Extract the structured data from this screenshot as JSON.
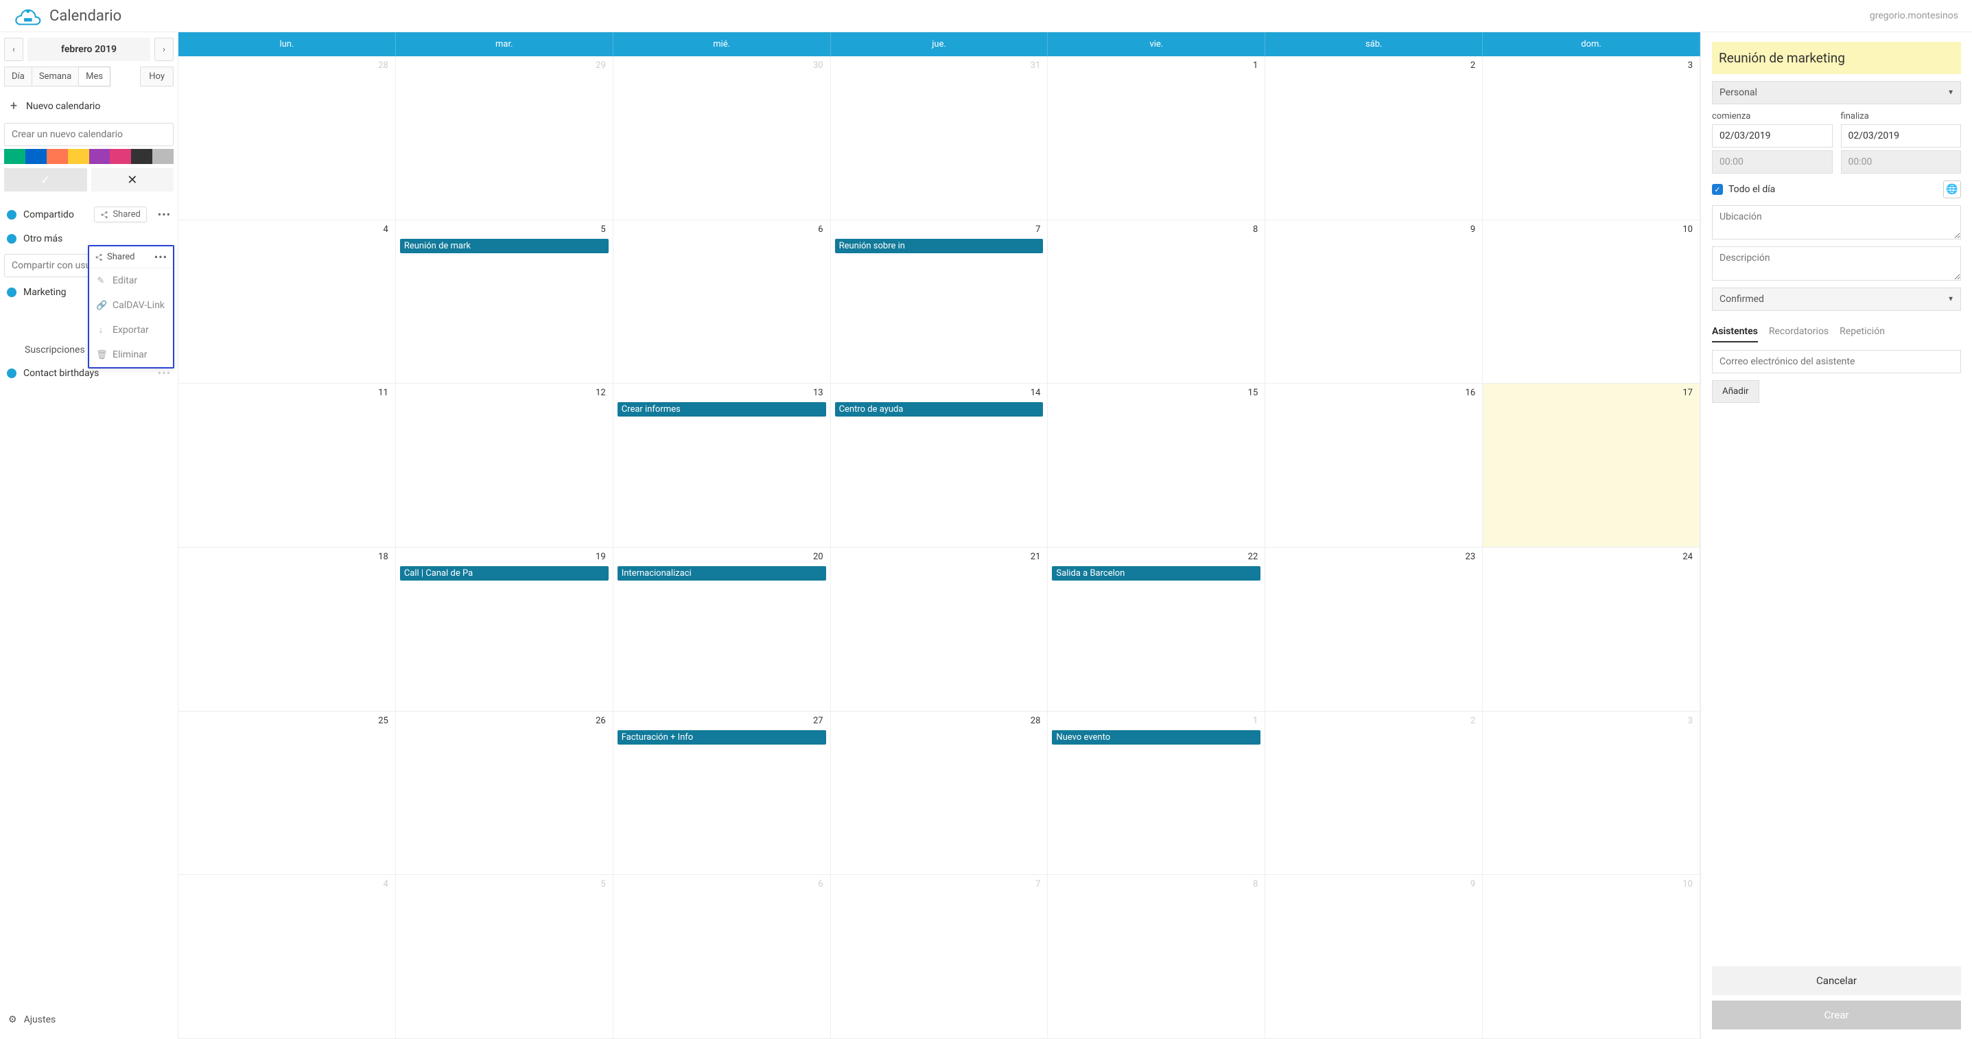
{
  "app": {
    "title": "Calendario",
    "user": "gregorio.montesinos"
  },
  "nav": {
    "month": "febrero 2019",
    "prev": "‹",
    "next": "›"
  },
  "views": {
    "day": "Día",
    "week": "Semana",
    "month": "Mes",
    "today": "Hoy"
  },
  "newcal": {
    "button": "Nuevo calendario",
    "placeholder": "Crear un nuevo calendario"
  },
  "colors": [
    "#00b07a",
    "#0066cc",
    "#ff7851",
    "#ffcc33",
    "#9c3db4",
    "#e23b7a",
    "#333333",
    "#bbbbbb"
  ],
  "calendars": {
    "compartido": "Compartido",
    "otromas": "Otro más",
    "marketing": "Marketing",
    "contactbd": "Contact birthdays",
    "share_placeholder": "Compartir con usu",
    "shared_tag": "Shared",
    "subs": "Suscripciones"
  },
  "dropdown": {
    "header": "Shared",
    "edit": "Editar",
    "caldav": "CalDAV-Link",
    "export": "Exportar",
    "delete": "Eliminar"
  },
  "settings": "Ajustes",
  "weekdays": [
    "lun.",
    "mar.",
    "mié.",
    "jue.",
    "vie.",
    "sáb.",
    "dom."
  ],
  "days": [
    {
      "n": "28",
      "dim": true
    },
    {
      "n": "29",
      "dim": true
    },
    {
      "n": "30",
      "dim": true
    },
    {
      "n": "31",
      "dim": true
    },
    {
      "n": "1"
    },
    {
      "n": "2"
    },
    {
      "n": "3"
    },
    {
      "n": "4"
    },
    {
      "n": "5",
      "ev": [
        "Reunión de mark"
      ]
    },
    {
      "n": "6"
    },
    {
      "n": "7",
      "ev": [
        "Reunión sobre in"
      ]
    },
    {
      "n": "8"
    },
    {
      "n": "9"
    },
    {
      "n": "10"
    },
    {
      "n": "11"
    },
    {
      "n": "12"
    },
    {
      "n": "13",
      "ev": [
        "Crear informes"
      ]
    },
    {
      "n": "14",
      "ev": [
        "Centro de ayuda"
      ]
    },
    {
      "n": "15"
    },
    {
      "n": "16"
    },
    {
      "n": "17",
      "today": true
    },
    {
      "n": "18"
    },
    {
      "n": "19",
      "ev": [
        "Call | Canal de Pa"
      ]
    },
    {
      "n": "20",
      "ev": [
        "Internacionalizaci"
      ]
    },
    {
      "n": "21"
    },
    {
      "n": "22",
      "ev": [
        "Salida a Barcelon"
      ]
    },
    {
      "n": "23"
    },
    {
      "n": "24"
    },
    {
      "n": "25"
    },
    {
      "n": "26"
    },
    {
      "n": "27",
      "ev": [
        "Facturación + Info"
      ]
    },
    {
      "n": "28"
    },
    {
      "n": "1",
      "dim": true,
      "ev": [
        "Nuevo evento"
      ]
    },
    {
      "n": "2",
      "dim": true
    },
    {
      "n": "3",
      "dim": true
    },
    {
      "n": "4",
      "dim": true
    },
    {
      "n": "5",
      "dim": true
    },
    {
      "n": "6",
      "dim": true
    },
    {
      "n": "7",
      "dim": true
    },
    {
      "n": "8",
      "dim": true
    },
    {
      "n": "9",
      "dim": true
    },
    {
      "n": "10",
      "dim": true
    }
  ],
  "detail": {
    "title": "Reunión de marketing",
    "calendar": "Personal",
    "start_label": "comienza",
    "end_label": "finaliza",
    "start_date": "02/03/2019",
    "end_date": "02/03/2019",
    "start_time": "00:00",
    "end_time": "00:00",
    "allday": "Todo el día",
    "location_ph": "Ubicación",
    "desc_ph": "Descripción",
    "status": "Confirmed",
    "tab_attendees": "Asistentes",
    "tab_reminders": "Recordatorios",
    "tab_repeat": "Repetición",
    "attendee_ph": "Correo electrónico del asistente",
    "add": "Añadir",
    "cancel": "Cancelar",
    "create": "Crear"
  }
}
